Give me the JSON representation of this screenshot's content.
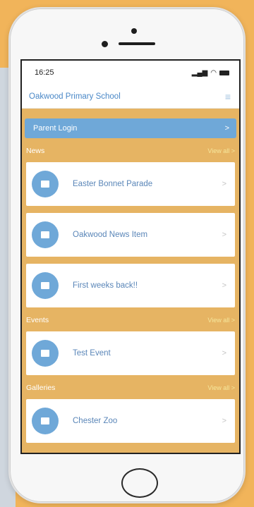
{
  "status_bar": {
    "time": "16:25",
    "signal": "▂▄▆",
    "wifi": "◠"
  },
  "header": {
    "title": "Oakwood Primary School",
    "menu_icon": "≡"
  },
  "parent_login": {
    "label": "Parent Login",
    "chevron": ">"
  },
  "sections": {
    "news": {
      "title": "News",
      "view_all": "View all >",
      "items": [
        {
          "title": "Easter Bonnet Parade"
        },
        {
          "title": "Oakwood News Item"
        },
        {
          "title": "First weeks back!!"
        }
      ]
    },
    "events": {
      "title": "Events",
      "view_all": "View all >",
      "items": [
        {
          "title": "Test Event"
        }
      ]
    },
    "galleries": {
      "title": "Galleries",
      "view_all": "View all >",
      "items": [
        {
          "title": "Chester Zoo"
        }
      ]
    }
  },
  "chevron": ">",
  "colors": {
    "background": "#f1b45a",
    "screen_bg": "#e6b463",
    "accent_blue": "#6fa8d8",
    "title_blue": "#4a88c7"
  }
}
